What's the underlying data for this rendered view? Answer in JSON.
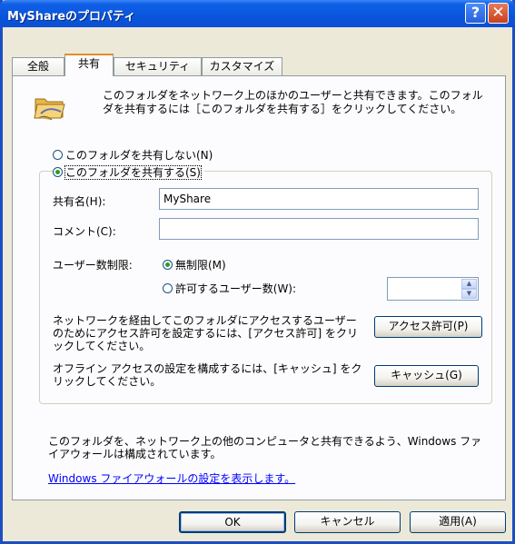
{
  "window": {
    "title": "MyShareのプロパティ",
    "help_glyph": "?",
    "close_glyph": "✕"
  },
  "tabs": [
    {
      "label": "全般"
    },
    {
      "label": "共有",
      "active": true
    },
    {
      "label": "セキュリティ"
    },
    {
      "label": "カスタマイズ"
    }
  ],
  "sharing": {
    "description": "このフォルダをネットワーク上のほかのユーザーと共有できます。このフォルダを共有するには［このフォルダを共有する］をクリックしてください。",
    "do_not_share": {
      "label": "このフォルダを共有しない(N)",
      "selected": false
    },
    "share": {
      "label": "このフォルダを共有する(S)",
      "selected": true
    },
    "share_name": {
      "label": "共有名(H):",
      "value": "MyShare"
    },
    "comment": {
      "label": "コメント(C):",
      "value": ""
    },
    "user_limit": {
      "label": "ユーザー数制限:",
      "unlimited": {
        "label": "無制限(M)",
        "selected": true
      },
      "allow_count": {
        "label": "許可するユーザー数(W):",
        "selected": false
      },
      "count_value": ""
    },
    "permissions": {
      "text": "ネットワークを経由してこのフォルダにアクセスするユーザーのためにアクセス許可を設定するには、[アクセス許可] をクリックしてください。",
      "button": "アクセス許可(P)"
    },
    "caching": {
      "text": "オフライン アクセスの設定を構成するには、[キャッシュ] をクリックしてください。",
      "button": "キャッシュ(G)"
    },
    "firewall_note": "このフォルダを、ネットワーク上の他のコンピュータと共有できるよう、Windows ファイアウォールは構成されています。",
    "firewall_link": "Windows ファイアウォールの設定を表示します。"
  },
  "footer": {
    "ok": "OK",
    "cancel": "キャンセル",
    "apply": "適用(A)"
  },
  "colors": {
    "titlebar": "#0a55dc",
    "dialog_bg": "#ece9d8",
    "active_tab_accent": "#e68b2c",
    "radio_checked": "#21a121",
    "link": "#0000ff"
  },
  "icons": {
    "folder": "shared-folder-icon"
  }
}
